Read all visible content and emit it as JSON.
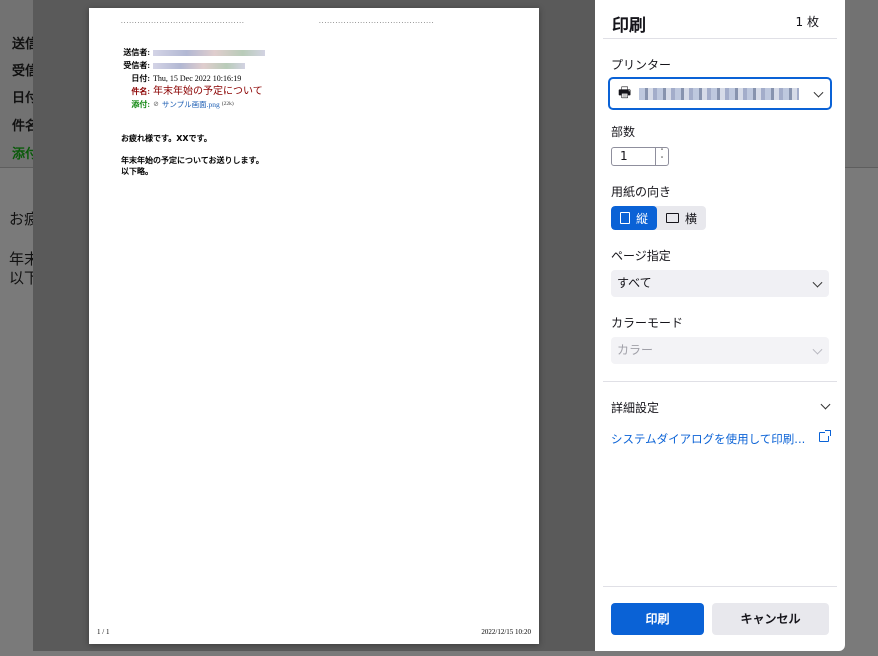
{
  "background": {
    "labels": [
      "送信",
      "受信",
      "日付",
      "件名",
      "添付"
    ],
    "body_lines": [
      "お疲",
      "年末",
      "以下"
    ]
  },
  "preview": {
    "meta": {
      "sender_key": "送信者:",
      "recipient_key": "受信者:",
      "date_key": "日付:",
      "date_value": "Thu, 15 Dec 2022 10:16:19",
      "subject_key": "件名:",
      "subject_value": "年末年始の予定について",
      "attach_key": "添付:",
      "attach_value": "サンプル画面.png",
      "attach_size": "(22k)"
    },
    "body": [
      "お疲れ様です。XXです。",
      "年末年始の予定についてお送りします。",
      "以下略。"
    ],
    "footer_page": "1 / 1",
    "footer_date": "2022/12/15 10:20"
  },
  "panel": {
    "title": "印刷",
    "sheets": "1 枚",
    "printer_label": "プリンター",
    "copies_label": "部数",
    "copies_value": "1",
    "orientation_label": "用紙の向き",
    "portrait": "縦",
    "landscape": "横",
    "pages_label": "ページ指定",
    "pages_value": "すべて",
    "color_label": "カラーモード",
    "color_value": "カラー",
    "details": "詳細設定",
    "system_dialog": "システムダイアログを使用して印刷...",
    "print_button": "印刷",
    "cancel_button": "キャンセル",
    "accent_color": "#0a62d6"
  }
}
